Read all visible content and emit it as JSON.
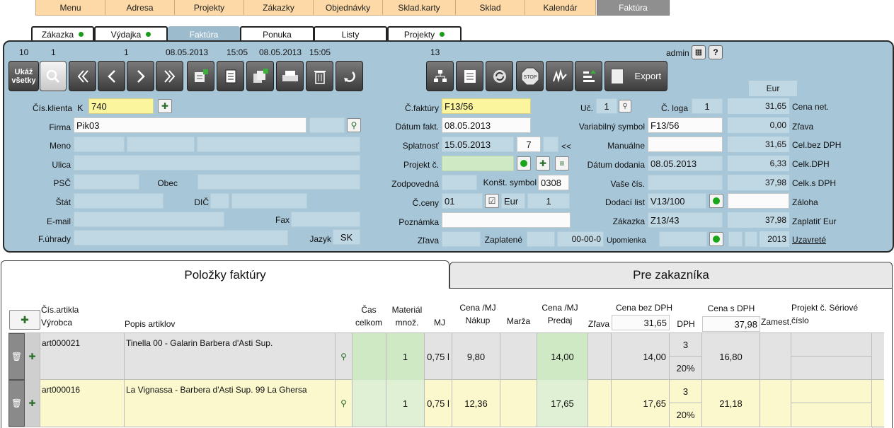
{
  "top_tabs": [
    {
      "label": "Menu",
      "active": false
    },
    {
      "label": "Adresa",
      "active": false
    },
    {
      "label": "Projekty",
      "active": false
    },
    {
      "label": "Zákazky",
      "active": false
    },
    {
      "label": "Objednávky",
      "active": false
    },
    {
      "label": "Sklad.karty",
      "active": false
    },
    {
      "label": "Sklad",
      "active": false
    },
    {
      "label": "Kalendár",
      "active": false
    },
    {
      "label": "Faktúra",
      "active": true
    }
  ],
  "sub_tabs": [
    {
      "label": "Zákazka",
      "dot": true
    },
    {
      "label": "Výdajka",
      "dot": true
    },
    {
      "label": "Faktúra",
      "dot": false,
      "active": true
    },
    {
      "label": "Ponuka",
      "dot": false
    },
    {
      "label": "Listy",
      "dot": false
    },
    {
      "label": "Projekty",
      "dot": true
    }
  ],
  "info_bar": {
    "v1": "10",
    "v2": "1",
    "v3": "1",
    "date1": "08.05.2013",
    "time1": "15:05",
    "date2": "08.05.2013",
    "time2": "15:05",
    "count": "13",
    "user": "admin"
  },
  "toolbar": {
    "show_all": "Ukáž všetky",
    "export": "Export"
  },
  "currency_header": "Eur",
  "client": {
    "cis_klienta_label": "Čís.klienta",
    "cis_klienta_prefix": "K",
    "cis_klienta": "740",
    "firma_label": "Firma",
    "firma": "Pik03",
    "meno_label": "Meno",
    "ulica_label": "Ulica",
    "psc_label": "PSČ",
    "obec_label": "Obec",
    "stat_label": "Štát",
    "dic_label": "DIČ",
    "email_label": "E-mail",
    "fax_label": "Fax",
    "fuhrady_label": "F.úhrady",
    "jazyk_label": "Jazyk",
    "jazyk": "SK"
  },
  "invoice": {
    "cfaktury_label": "Č.faktúry",
    "cfaktury": "F13/56",
    "datum_fakt_label": "Dátum fakt.",
    "datum_fakt": "08.05.2013",
    "splatnost_label": "Splatnosť",
    "splatnost": "15.05.2013",
    "splatnost_days": "7",
    "splatnost_btn": "<<",
    "projekt_label": "Projekt č.",
    "zodpovedna_label": "Zodpovedná",
    "konst_label": "Konšt. symbol",
    "konst": "0308",
    "cceny_label": "Č.ceny",
    "cceny": "01",
    "cceny_cur": "Eur",
    "cceny_num": "1",
    "poznamka_label": "Poznámka",
    "zlava_label": "Zľava",
    "zaplatene_label": "Zaplatené",
    "zaplatene_date": "00-00-0",
    "upomienka_label": "Upomienka"
  },
  "right": {
    "uct_label": "Uč.",
    "uct": "1",
    "cloga_label": "Č. loga",
    "cloga": "1",
    "varsym_label": "Variabilný symbol",
    "varsym": "F13/56",
    "manualne_label": "Manuálne",
    "datum_dodania_label": "Dátum dodania",
    "datum_dodania": "08.05.2013",
    "vase_label": "Vaše čís.",
    "dodaci_label": "Dodací list",
    "dodaci": "V13/100",
    "zakazka_label": "Zákazka",
    "zakazka": "Z13/43",
    "year": "2013"
  },
  "totals": [
    {
      "value": "31,65",
      "label": "Cena net."
    },
    {
      "value": "0,00",
      "label": "Zľava"
    },
    {
      "value": "31,65",
      "label": "Cel.bez DPH"
    },
    {
      "value": "6,33",
      "label": "Celk.DPH"
    },
    {
      "value": "37,98",
      "label": "Celk.s DPH"
    },
    {
      "value": "",
      "label": "Záloha"
    },
    {
      "value": "37,98",
      "label": "Zaplatiť Eur"
    }
  ],
  "uzavrete_label": "Uzavreté",
  "bottom_tabs": {
    "items": "Položky faktúry",
    "customer": "Pre zakazníka"
  },
  "table_headers": {
    "cis_artikla": "Čís.artikla",
    "vyrobca": "Výrobca",
    "popis": "Popis artiklov",
    "cas": "Čas celkom",
    "material": "Materiál množ.",
    "mj": "MJ",
    "cena_nakup": "Cena /MJ Nákup",
    "marza": "Marža",
    "cena_predaj": "Cena /MJ Predaj",
    "zlava": "Zľava",
    "cena_bez": "Cena bez DPH",
    "cena_bez_total": "31,65",
    "dph": "DPH",
    "cena_s": "Cena s DPH",
    "cena_s_total": "37,98",
    "zamest": "Zamest.",
    "projekt": "Projekt č. Sériové číslo"
  },
  "rows": [
    {
      "article": "art000021",
      "desc": "Tinella 00 - Galarin Barbera d'Asti Sup.",
      "qty": "1",
      "mj": "0,75 l",
      "nakup": "9,80",
      "predaj": "14,00",
      "bez": "14,00",
      "dph_n": "3",
      "dph_p": "20%",
      "s_dph": "16,80",
      "highlight": false
    },
    {
      "article": "art000016",
      "desc": "La Vignassa - Barbera d'Asti Sup. 99 La Ghersa",
      "qty": "1",
      "mj": "0,75 l",
      "nakup": "12,36",
      "predaj": "17,65",
      "bez": "17,65",
      "dph_n": "3",
      "dph_p": "20%",
      "s_dph": "21,18",
      "highlight": true
    }
  ]
}
